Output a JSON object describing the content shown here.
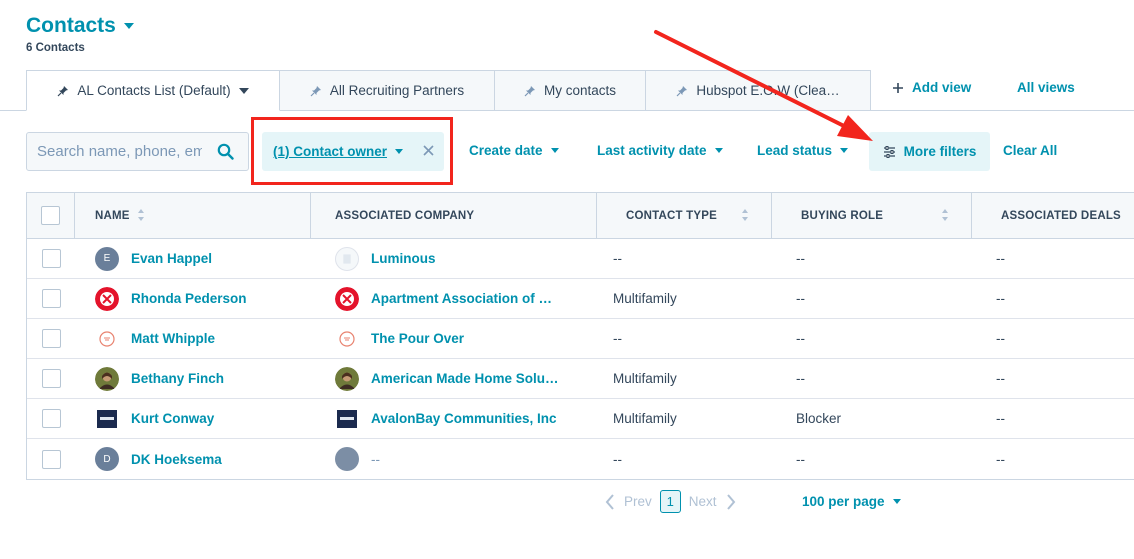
{
  "header": {
    "title": "Contacts",
    "count": "6 Contacts"
  },
  "tabs": [
    {
      "label": "AL Contacts List (Default)"
    },
    {
      "label": "All Recruiting Partners"
    },
    {
      "label": "My contacts"
    },
    {
      "label": "Hubspot E.O.W (Clea…"
    }
  ],
  "tab_actions": {
    "add_view": "Add view",
    "all_views": "All views"
  },
  "search": {
    "placeholder": "Search name, phone, email"
  },
  "filters": {
    "contact_owner": "(1) Contact owner",
    "create_date": "Create date",
    "last_activity": "Last activity date",
    "lead_status": "Lead status",
    "more_filters": "More filters",
    "clear_all": "Clear All"
  },
  "table": {
    "headers": [
      "NAME",
      "ASSOCIATED COMPANY",
      "CONTACT TYPE",
      "BUYING ROLE",
      "ASSOCIATED DEALS"
    ],
    "rows": [
      {
        "name": "Evan Happel",
        "company": "Luminous",
        "type": "--",
        "role": "--",
        "deals": "--"
      },
      {
        "name": "Rhonda Pederson",
        "company": "Apartment Association of …",
        "type": "Multifamily",
        "role": "--",
        "deals": "--"
      },
      {
        "name": "Matt Whipple",
        "company": "The Pour Over",
        "type": "--",
        "role": "--",
        "deals": "--"
      },
      {
        "name": "Bethany Finch",
        "company": "American Made Home Solu…",
        "type": "Multifamily",
        "role": "--",
        "deals": "--"
      },
      {
        "name": "Kurt Conway",
        "company": "AvalonBay Communities, Inc",
        "type": "Multifamily",
        "role": "Blocker",
        "deals": "--"
      },
      {
        "name": "DK Hoeksema",
        "company": "--",
        "type": "--",
        "role": "--",
        "deals": "--"
      }
    ],
    "avatar_initials": {
      "evan": "E",
      "dk": "D"
    }
  },
  "pagination": {
    "prev": "Prev",
    "page": "1",
    "next": "Next",
    "per_page": "100 per page"
  },
  "colors": {
    "accent": "#0091ae",
    "highlight": "#f2251d",
    "chip_bg": "#e5f5f8"
  }
}
